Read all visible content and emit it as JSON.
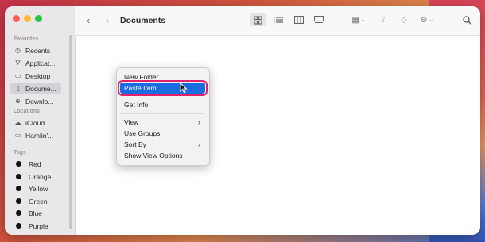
{
  "window": {
    "title": "Documents"
  },
  "sidebar": {
    "favorites_header": "Favorites",
    "favorites": [
      {
        "label": "Recents",
        "icon": "clock-icon"
      },
      {
        "label": "Applicat...",
        "icon": "applications-icon"
      },
      {
        "label": "Desktop",
        "icon": "desktop-icon"
      },
      {
        "label": "Docume...",
        "icon": "document-icon",
        "selected": true
      },
      {
        "label": "Downlo...",
        "icon": "download-icon"
      }
    ],
    "locations_header": "Locations",
    "locations": [
      {
        "label": "iCloud...",
        "icon": "cloud-icon"
      },
      {
        "label": "Hamlin'...",
        "icon": "computer-icon"
      }
    ],
    "tags_header": "Tags",
    "tags": [
      {
        "label": "Red"
      },
      {
        "label": "Orange"
      },
      {
        "label": "Yellow"
      },
      {
        "label": "Green"
      },
      {
        "label": "Blue"
      },
      {
        "label": "Purple"
      }
    ]
  },
  "context_menu": {
    "items": [
      {
        "label": "New Folder"
      },
      {
        "label": "Paste Item",
        "highlighted": true
      },
      {
        "label": "Get Info"
      },
      {
        "label": "View",
        "submenu": true
      },
      {
        "label": "Use Groups"
      },
      {
        "label": "Sort By",
        "submenu": true
      },
      {
        "label": "Show View Options"
      }
    ]
  },
  "colors": {
    "highlight": "#1b6ce0",
    "annotation_outline": "#e3206a"
  }
}
